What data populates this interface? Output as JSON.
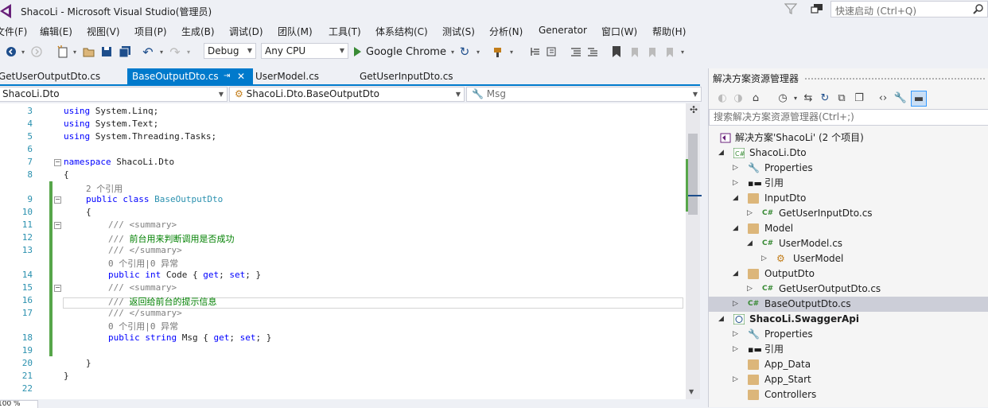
{
  "window": {
    "title": "ShacoLi - Microsoft Visual Studio(管理员)",
    "quick_launch_placeholder": "快速启动 (Ctrl+Q)"
  },
  "menu": [
    "文件(F)",
    "编辑(E)",
    "视图(V)",
    "项目(P)",
    "生成(B)",
    "调试(D)",
    "团队(M)",
    "工具(T)",
    "体系结构(C)",
    "测试(S)",
    "分析(N)",
    "Generator",
    "窗口(W)",
    "帮助(H)"
  ],
  "toolbar": {
    "configuration": "Debug",
    "platform": "Any CPU",
    "run_target": "Google Chrome"
  },
  "tabs": [
    {
      "label": "GetUserOutputDto.cs",
      "active": false
    },
    {
      "label": "BaseOutputDto.cs",
      "active": true
    },
    {
      "label": "UserModel.cs",
      "active": false
    },
    {
      "label": "GetUserInputDto.cs",
      "active": false
    }
  ],
  "navbar": {
    "project": "ShacoLi.Dto",
    "type": "ShacoLi.Dto.BaseOutputDto",
    "member": "Msg"
  },
  "editor": {
    "line_numbers": [
      "3",
      "4",
      "5",
      "6",
      "7",
      "8",
      "9",
      "10",
      "11",
      "12",
      "13",
      "14",
      "15",
      "16",
      "17",
      "18",
      "19",
      "20",
      "21",
      "22"
    ],
    "code": {
      "l3_kw": "using",
      "l3_rest": " System.Linq;",
      "l4_kw": "using",
      "l4_rest": " System.Text;",
      "l5_kw": "using",
      "l5_rest": " System.Threading.Tasks;",
      "l7_kw": "namespace",
      "l7_rest": " ShacoLi.Dto",
      "brace_open": "{",
      "lens_class": "2 个引用",
      "l9_kw": "public class",
      "l9_type": "BaseOutputDto",
      "l11_slash": "///",
      "l11_tag": " <summary>",
      "l12_slash": "///",
      "l12_text": " 前台用来判断调用是否成功",
      "l13_slash": "///",
      "l13_tag": " </summary>",
      "lens_code": "0 个引用|0 异常",
      "l14_kw": "public int",
      "l14_rest": " Code { ",
      "l14_get": "get",
      "l14_mid": "; ",
      "l14_set": "set",
      "l14_end": "; }",
      "l15_slash": "///",
      "l15_tag": " <summary>",
      "l16_slash": "///",
      "l16_text": " 返回给前台的提示信息",
      "l17_slash": "///",
      "l17_tag": " </summary>",
      "lens_msg": "0 个引用|0 异常",
      "l18_kw": "public string",
      "l18_rest": " Msg { ",
      "l18_get": "get",
      "l18_mid": "; ",
      "l18_set": "set",
      "l18_end": "; }",
      "brace_close": "}"
    },
    "zoom": "100 %"
  },
  "solution_explorer": {
    "title": "解决方案资源管理器",
    "search_placeholder": "搜索解决方案资源管理器(Ctrl+;)",
    "items": [
      {
        "label": "解决方案'ShacoLi' (2 个项目)"
      },
      {
        "label": "ShacoLi.Dto"
      },
      {
        "label": "Properties"
      },
      {
        "label": "引用"
      },
      {
        "label": "InputDto"
      },
      {
        "label": "GetUserInputDto.cs"
      },
      {
        "label": "Model"
      },
      {
        "label": "UserModel.cs"
      },
      {
        "label": "UserModel"
      },
      {
        "label": "OutputDto"
      },
      {
        "label": "GetUserOutputDto.cs"
      },
      {
        "label": "BaseOutputDto.cs"
      },
      {
        "label": "ShacoLi.SwaggerApi"
      },
      {
        "label": "Properties"
      },
      {
        "label": "引用"
      },
      {
        "label": "App_Data"
      },
      {
        "label": "App_Start"
      },
      {
        "label": "Controllers"
      }
    ]
  },
  "colors": {
    "accent": "#007acc",
    "keyword": "#0000ff",
    "type": "#2b91af",
    "comment": "#008000",
    "change_bar": "#57a64a"
  }
}
